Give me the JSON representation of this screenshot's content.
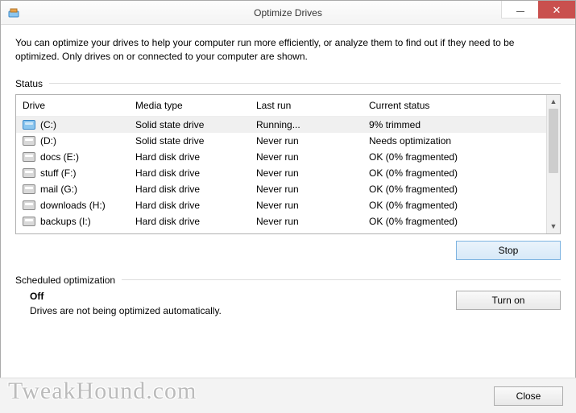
{
  "window": {
    "title": "Optimize Drives"
  },
  "intro": "You can optimize your drives to help your computer run more efficiently, or analyze them to find out if they need to be optimized. Only drives on or connected to your computer are shown.",
  "status_header": "Status",
  "columns": {
    "drive": "Drive",
    "media": "Media type",
    "lastrun": "Last run",
    "status": "Current status"
  },
  "drives": [
    {
      "name": "(C:)",
      "media": "Solid state drive",
      "lastrun": "Running...",
      "status": "9% trimmed",
      "primary": true
    },
    {
      "name": "(D:)",
      "media": "Solid state drive",
      "lastrun": "Never run",
      "status": "Needs optimization"
    },
    {
      "name": "docs (E:)",
      "media": "Hard disk drive",
      "lastrun": "Never run",
      "status": "OK (0% fragmented)"
    },
    {
      "name": "stuff (F:)",
      "media": "Hard disk drive",
      "lastrun": "Never run",
      "status": "OK (0% fragmented)"
    },
    {
      "name": "mail (G:)",
      "media": "Hard disk drive",
      "lastrun": "Never run",
      "status": "OK (0% fragmented)"
    },
    {
      "name": "downloads (H:)",
      "media": "Hard disk drive",
      "lastrun": "Never run",
      "status": "OK (0% fragmented)"
    },
    {
      "name": "backups (I:)",
      "media": "Hard disk drive",
      "lastrun": "Never run",
      "status": "OK (0% fragmented)"
    }
  ],
  "buttons": {
    "stop": "Stop",
    "turnon": "Turn on",
    "close": "Close"
  },
  "schedule": {
    "header": "Scheduled optimization",
    "state": "Off",
    "desc": "Drives are not being optimized automatically."
  },
  "watermark": "TweakHound.com"
}
